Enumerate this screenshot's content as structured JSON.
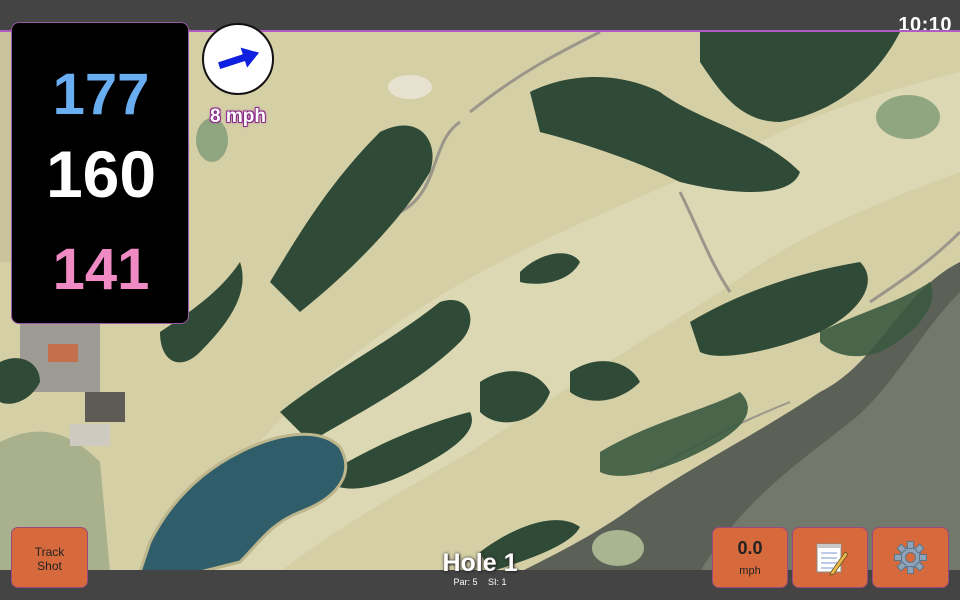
{
  "status": {
    "clock": "10:10"
  },
  "distances": {
    "back": "177",
    "middle": "160",
    "front": "141"
  },
  "wind": {
    "speed_label": "8 mph",
    "direction_icon": "arrow-right-icon"
  },
  "hole": {
    "title": "Hole 1",
    "par_label": "Par: 5",
    "si_label": "SI: 1"
  },
  "buttons": {
    "track_shot": "Track Shot",
    "wind_value": "0.0",
    "wind_unit": "mph",
    "notes_icon": "notepad-icon",
    "settings_icon": "gear-icon"
  },
  "colors": {
    "back_distance": "#6aaef2",
    "middle_distance": "#ffffff",
    "front_distance": "#f08ac4",
    "button_bg": "#d66a3c",
    "accent_border": "#b05cc0"
  }
}
